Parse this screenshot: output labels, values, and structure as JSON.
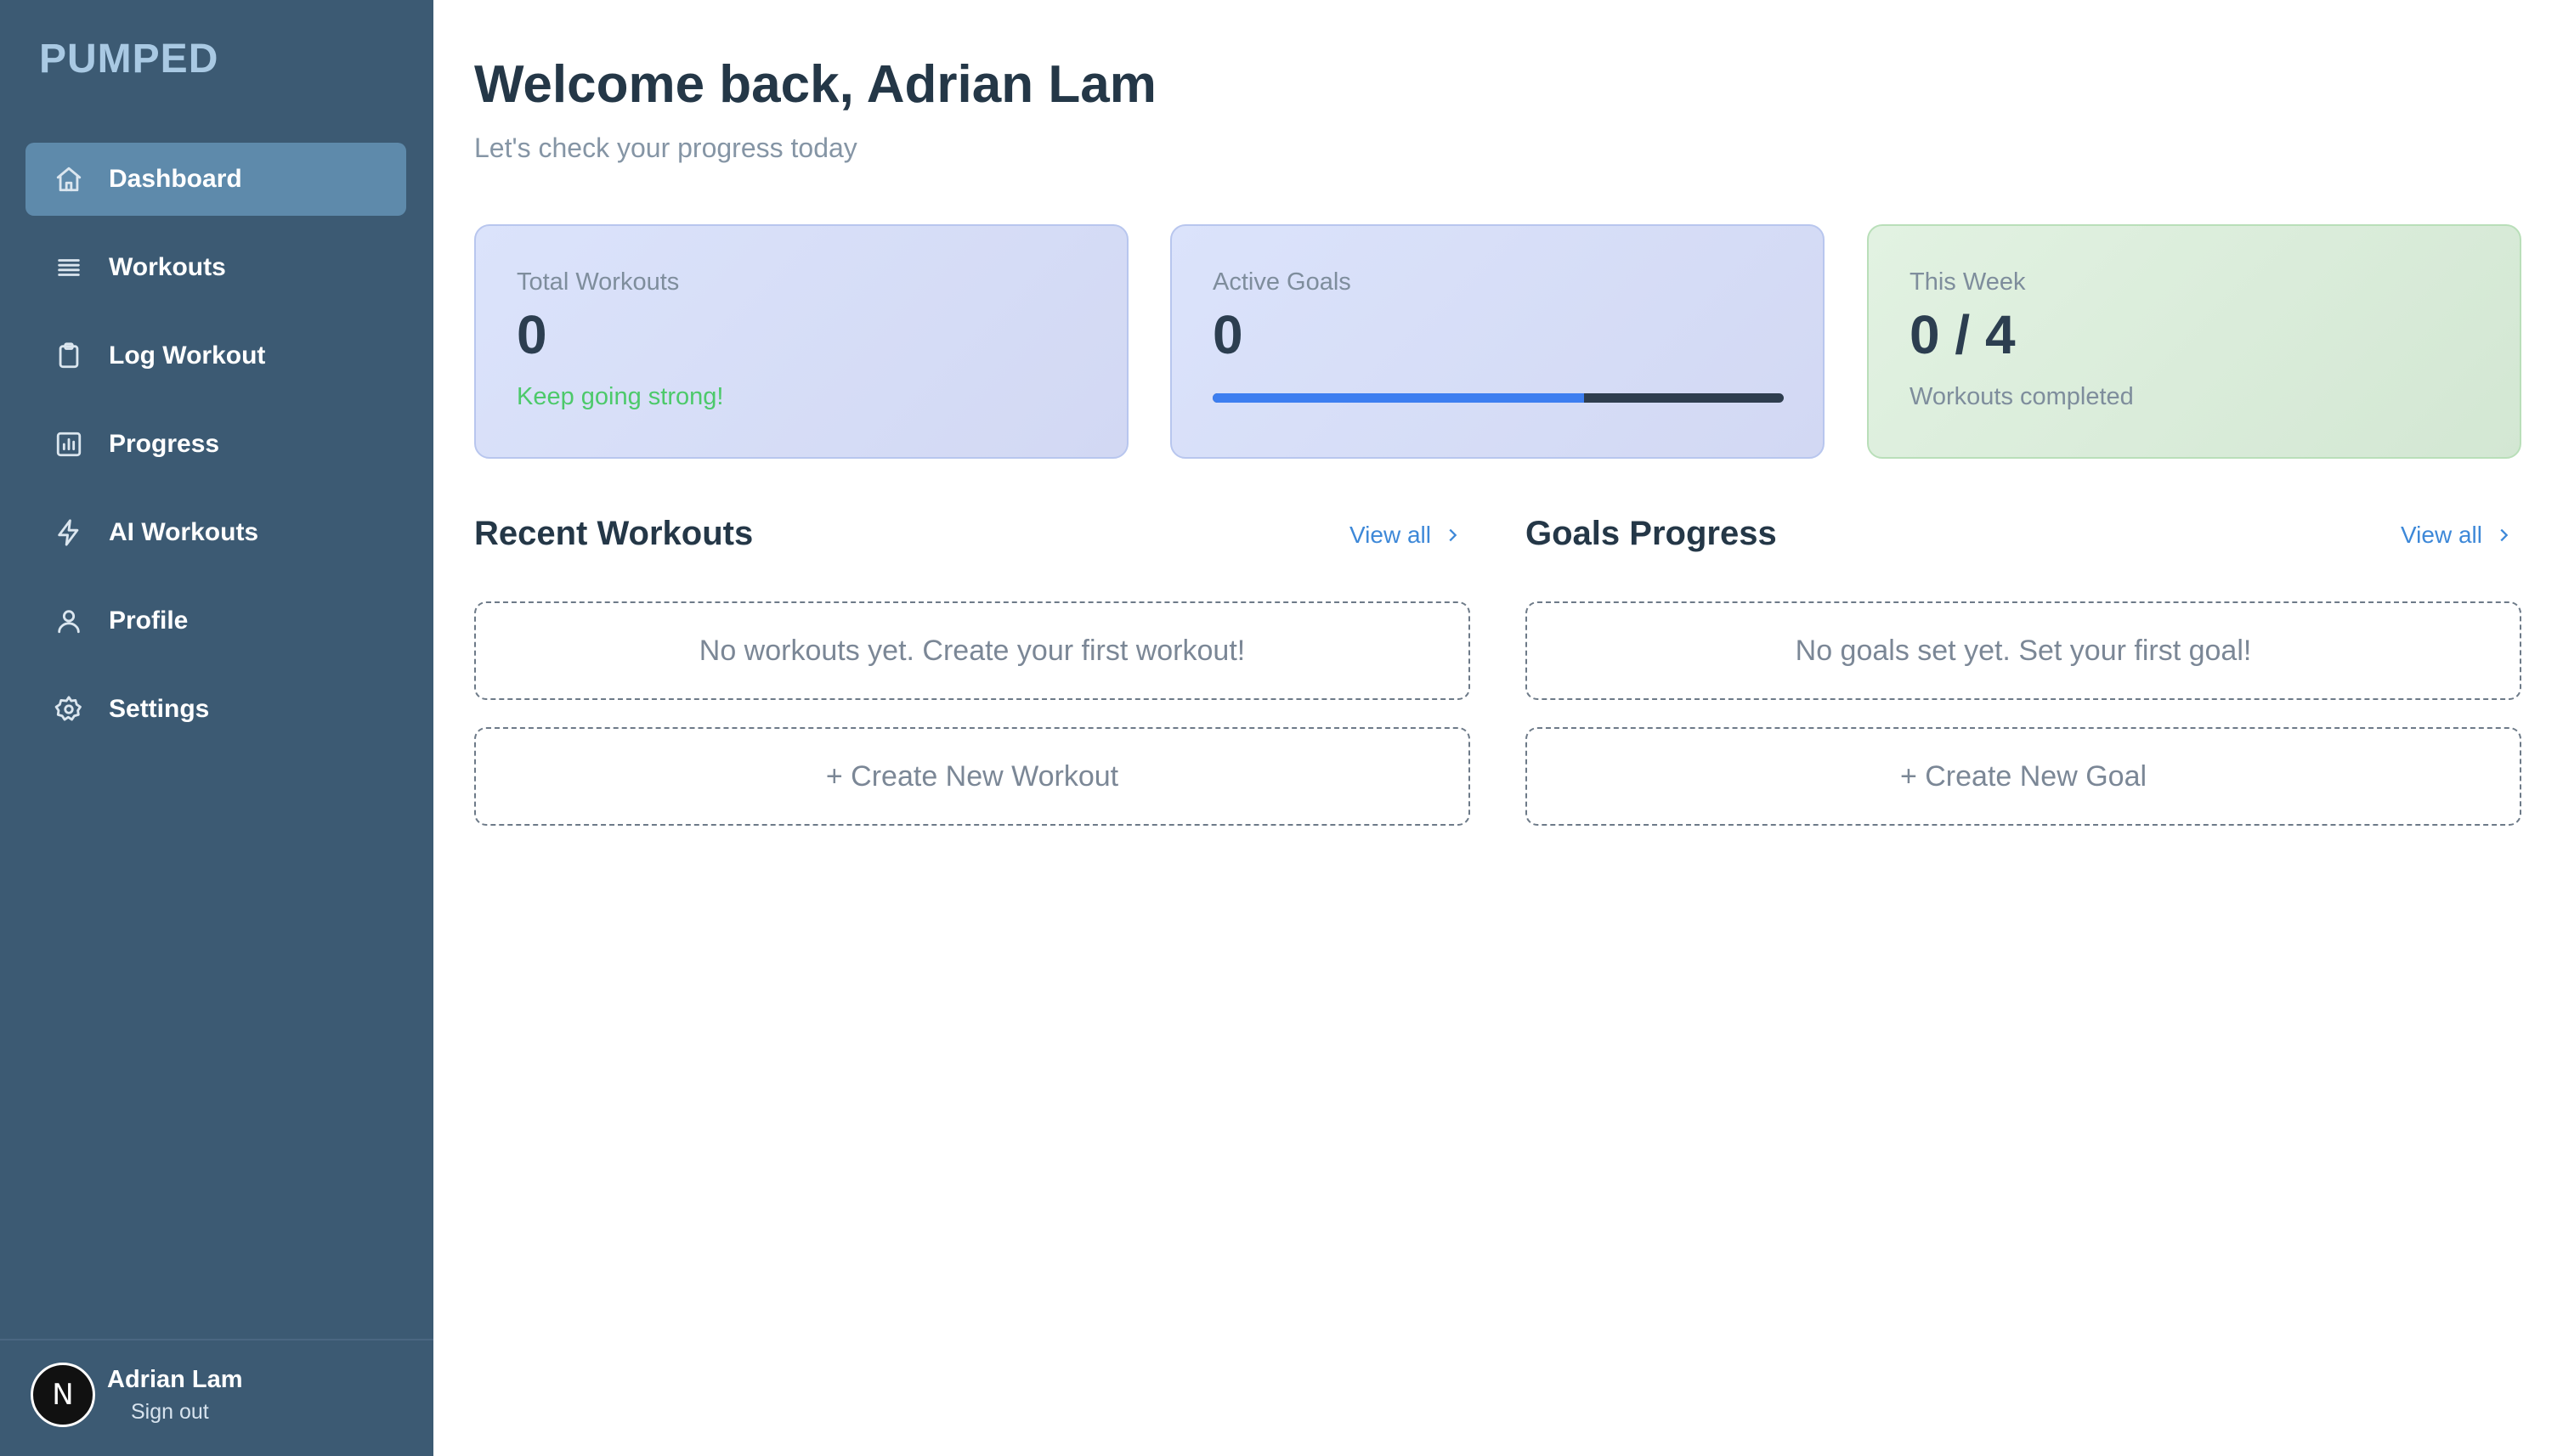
{
  "brand": "PUMPED",
  "nav": [
    {
      "label": "Dashboard",
      "icon": "home-icon",
      "active": true
    },
    {
      "label": "Workouts",
      "icon": "list-icon",
      "active": false
    },
    {
      "label": "Log Workout",
      "icon": "clipboard-icon",
      "active": false
    },
    {
      "label": "Progress",
      "icon": "bar-chart-icon",
      "active": false
    },
    {
      "label": "AI Workouts",
      "icon": "lightning-icon",
      "active": false
    },
    {
      "label": "Profile",
      "icon": "user-icon",
      "active": false
    },
    {
      "label": "Settings",
      "icon": "gear-icon",
      "active": false
    }
  ],
  "user": {
    "name": "Adrian Lam",
    "initial": "N",
    "sign_out": "Sign out"
  },
  "header": {
    "title": "Welcome back, Adrian Lam",
    "subtitle": "Let's check your progress today"
  },
  "cards": {
    "total": {
      "label": "Total Workouts",
      "value": "0",
      "note": "Keep going strong!"
    },
    "goals": {
      "label": "Active Goals",
      "value": "0",
      "progress": 0.65
    },
    "week": {
      "label": "This Week",
      "value": "0 / 4",
      "note": "Workouts completed"
    }
  },
  "recent": {
    "title": "Recent Workouts",
    "view_all": "View all",
    "empty": "No workouts yet. Create your first workout!",
    "create": "+ Create New Workout"
  },
  "goals": {
    "title": "Goals Progress",
    "view_all": "View all",
    "empty": "No goals set yet. Set your first goal!",
    "create": "+ Create New Goal"
  },
  "colors": {
    "sidebar": "#3c5a73",
    "active_nav": "#5e8aab",
    "accent": "#3d88d8",
    "progress": "#3d7ef0",
    "success": "#4cc96a"
  }
}
